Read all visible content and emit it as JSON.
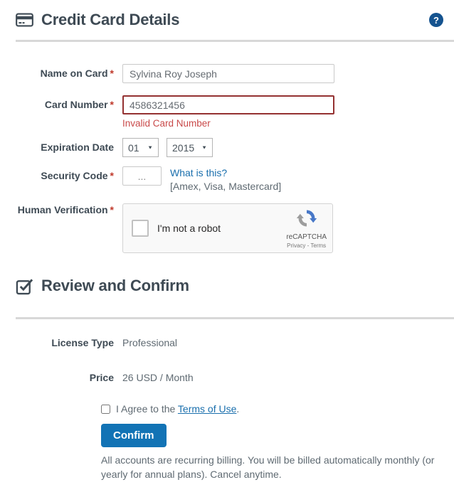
{
  "credit_card": {
    "title": "Credit Card Details",
    "required_marker": "*",
    "fields": {
      "name_on_card": {
        "label": "Name on Card",
        "value": "Sylvina Roy Joseph"
      },
      "card_number": {
        "label": "Card Number",
        "value": "4586321456",
        "error": "Invalid Card Number"
      },
      "expiration": {
        "label": "Expiration Date",
        "month": "01",
        "year": "2015"
      },
      "security_code": {
        "label": "Security Code",
        "placeholder": "...",
        "help_link": "What is this?",
        "hint": "[Amex, Visa, Mastercard]"
      },
      "human_verification": {
        "label": "Human Verification"
      }
    },
    "recaptcha": {
      "checkbox_label": "I'm not a robot",
      "brand": "reCAPTCHA",
      "privacy_terms": "Privacy - Terms"
    }
  },
  "review": {
    "title": "Review and Confirm",
    "license_type": {
      "label": "License Type",
      "value": "Professional"
    },
    "price": {
      "label": "Price",
      "value": "26 USD / Month"
    },
    "agreement": {
      "prefix": "I Agree to the ",
      "link_text": "Terms of Use",
      "suffix": "."
    },
    "confirm_button": "Confirm",
    "disclaimer": "All accounts are recurring billing. You will be billed automatically monthly (or yearly for annual plans). Cancel anytime."
  },
  "icons": {
    "select_arrow": "▼",
    "help_glyph": "?"
  },
  "colors": {
    "heading_text": "#3e4a54",
    "required_red": "#c0392b",
    "error_text": "#c94a4a",
    "error_border": "#943131",
    "link_blue": "#1a6fad",
    "button_blue": "#1273b5",
    "help_icon_blue": "#15538f",
    "divider_gray": "#d8d8d8"
  }
}
